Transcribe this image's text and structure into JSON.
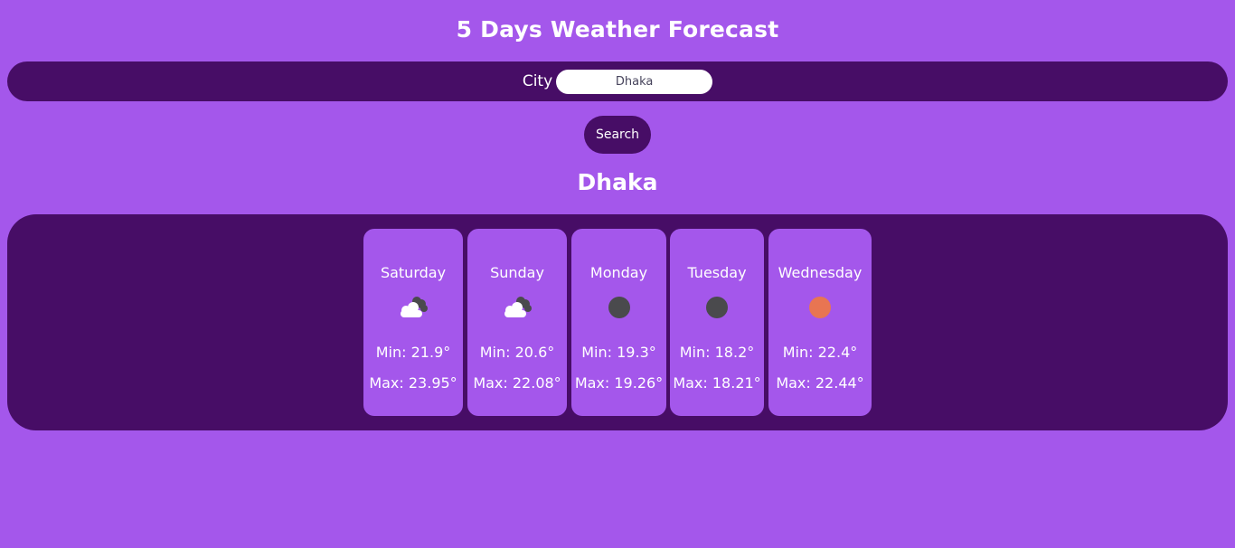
{
  "page_title": "5 Days Weather Forecast",
  "search": {
    "city_label": "City",
    "city_value": "Dhaka",
    "button_label": "Search"
  },
  "city_heading": "Dhaka",
  "colors": {
    "background": "#a457eb",
    "panel": "#470d66",
    "dark_circle": "#4a4a4d",
    "sun_orange": "#e87552"
  },
  "forecast": [
    {
      "day": "Saturday",
      "icon": "cloud-night-icon",
      "min": "Min: 21.9°",
      "max": "Max: 23.95°"
    },
    {
      "day": "Sunday",
      "icon": "cloud-night-icon",
      "min": "Min: 20.6°",
      "max": "Max: 22.08°"
    },
    {
      "day": "Monday",
      "icon": "dark-circle-icon",
      "min": "Min: 19.3°",
      "max": "Max: 19.26°"
    },
    {
      "day": "Tuesday",
      "icon": "dark-circle-icon",
      "min": "Min: 18.2°",
      "max": "Max: 18.21°"
    },
    {
      "day": "Wednesday",
      "icon": "sun-icon",
      "min": "Min: 22.4°",
      "max": "Max: 22.44°"
    }
  ]
}
